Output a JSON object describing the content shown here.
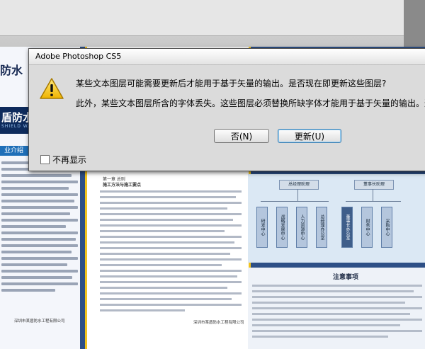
{
  "dialog": {
    "title": "Adobe Photoshop CS5",
    "message_line1": "某些文本图层可能需要更新后才能用于基于矢量的输出。是否现在即更新这些图层?",
    "message_line2": "此外，某些文本图层所含的字体丢失。这些图层必须替换所缺字体才能用于基于矢量的输出。这",
    "no_button": "否(N)",
    "update_button": "更新(U)",
    "dont_show_again": "不再显示",
    "dont_show_checked": false,
    "icon": "warning-icon"
  },
  "document": {
    "brand_partial": "防水",
    "brand_dark_partial": "盾防水",
    "brand_sub_partial": "SHIELD WATERP",
    "intro_tab_partial": "业介绍",
    "left_footer": "深圳市某盾防水工程有限公司",
    "mid_heading": "第一章 总则",
    "mid_subheading": "施工方法与施工要点",
    "mid_footer": "深圳市某盾防水工程有限公司",
    "notes_title": "注意事项",
    "org_chart": {
      "top_left": "总经理助理",
      "top_right": "董事长助理",
      "left_units": [
        "研发中心",
        "战略发展中心",
        "人力资源中心",
        "总经理办公室"
      ],
      "right_units": [
        "董事长办公室",
        "财务中心",
        "采购中心"
      ]
    }
  },
  "colors": {
    "dialog_bg": "#dbdbdb",
    "doc_blue": "#2d4f86",
    "accent_yellow": "#f1c21c"
  }
}
